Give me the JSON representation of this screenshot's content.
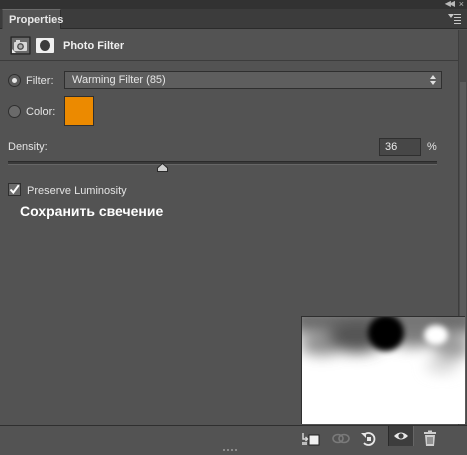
{
  "window": {
    "tab_label": "Properties",
    "collapse_icon": "double-chevron-left-icon",
    "close_icon": "close-icon",
    "menu_icon": "panel-menu-icon"
  },
  "header": {
    "adjustment_icon": "adjustment-layer-camera-icon",
    "mask_icon": "layer-mask-icon",
    "title": "Photo Filter"
  },
  "filter": {
    "label": "Filter:",
    "selected": true,
    "value": "Warming Filter (85)"
  },
  "color": {
    "label": "Color:",
    "selected": false,
    "swatch": "#ec8a00"
  },
  "density": {
    "label": "Density:",
    "value": "36",
    "unit": "%",
    "slider_fraction": 0.36
  },
  "preserve_luminosity": {
    "label": "Preserve Luminosity",
    "checked": true
  },
  "annotation": {
    "text": "Сохранить свечение"
  },
  "preview": {
    "kind": "layer-preview-thumbnail"
  },
  "toolbar": {
    "clip_icon": "clip-to-layer-icon",
    "view_previous_icon": "view-previous-state-icon",
    "reset_icon": "reset-adjustments-icon",
    "visibility_icon": "eye-visibility-icon",
    "delete_icon": "trash-icon",
    "grip_icon": "resize-grip-icon"
  },
  "colors": {
    "panel_bg": "#535353",
    "tab_bar": "#3c3c3c",
    "text": "#e6e6e6",
    "accent_swatch": "#ec8a00"
  }
}
